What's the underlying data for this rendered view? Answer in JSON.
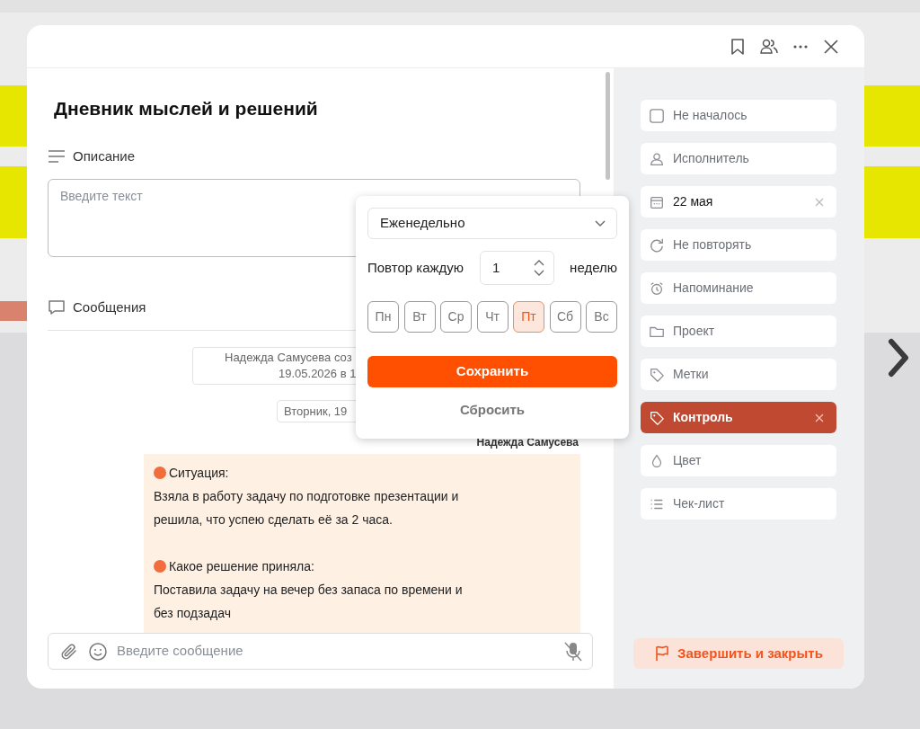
{
  "task": {
    "title": "Дневник мыслей и решений",
    "description": {
      "label": "Описание",
      "placeholder": "Введите текст"
    },
    "messages_label": "Сообщения"
  },
  "chat": {
    "system_note": [
      "Надежда Самусева соз",
      "19.05.2026 в 1"
    ],
    "date_chip": "Вторник, 19",
    "author": "Надежда Самусева",
    "message": [
      {
        "heading": "Ситуация:",
        "lines": [
          "Взяла в работу задачу по подготовке презентации и",
          "решила, что успею сделать её за 2 часа."
        ]
      },
      {
        "heading": "Какое решение приняла:",
        "lines": [
          "Поставила задачу на вечер без запаса по времени и",
          "без подзадач"
        ]
      }
    ],
    "input_placeholder": "Введите сообщение"
  },
  "repeat_popup": {
    "frequency": "Еженедельно",
    "repeat_label": "Повтор каждую",
    "interval": "1",
    "unit": "неделю",
    "days": [
      {
        "label": "Пн",
        "selected": false
      },
      {
        "label": "Вт",
        "selected": false
      },
      {
        "label": "Ср",
        "selected": false
      },
      {
        "label": "Чт",
        "selected": false
      },
      {
        "label": "Пт",
        "selected": true
      },
      {
        "label": "Сб",
        "selected": false
      },
      {
        "label": "Вс",
        "selected": false
      }
    ],
    "save": "Сохранить",
    "reset": "Сбросить"
  },
  "sidebar": {
    "items": [
      {
        "kind": "status",
        "label": "Не началось",
        "has_value": false,
        "selected": false,
        "clearable": false
      },
      {
        "kind": "assignee",
        "label": "Исполнитель",
        "has_value": false,
        "selected": false,
        "clearable": false
      },
      {
        "kind": "date",
        "label": "22 мая",
        "has_value": true,
        "selected": false,
        "clearable": true
      },
      {
        "kind": "repeat",
        "label": "Не повторять",
        "has_value": false,
        "selected": false,
        "clearable": false
      },
      {
        "kind": "reminder",
        "label": "Напоминание",
        "has_value": false,
        "selected": false,
        "clearable": false
      },
      {
        "kind": "project",
        "label": "Проект",
        "has_value": false,
        "selected": false,
        "clearable": false
      },
      {
        "kind": "tag",
        "label": "Метки",
        "has_value": false,
        "selected": false,
        "clearable": false
      },
      {
        "kind": "tag",
        "label": "Контроль",
        "has_value": true,
        "selected": true,
        "clearable": true
      },
      {
        "kind": "color",
        "label": "Цвет",
        "has_value": false,
        "selected": false,
        "clearable": false
      },
      {
        "kind": "checklist",
        "label": "Чек-лист",
        "has_value": false,
        "selected": false,
        "clearable": false
      }
    ],
    "finish_button": "Завершить и закрыть"
  }
}
